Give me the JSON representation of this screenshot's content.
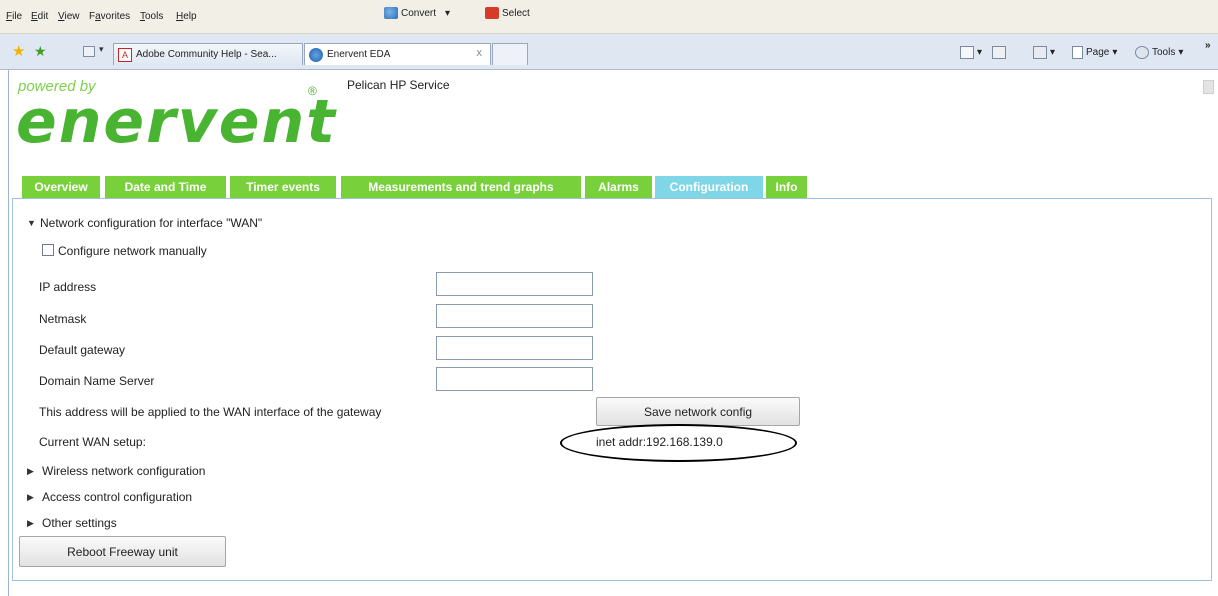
{
  "browser": {
    "menu": [
      {
        "pre": "",
        "u": "F",
        "post": "ile"
      },
      {
        "pre": "",
        "u": "E",
        "post": "dit"
      },
      {
        "pre": "",
        "u": "V",
        "post": "iew"
      },
      {
        "pre": "F",
        "u": "a",
        "post": "vorites"
      },
      {
        "pre": "",
        "u": "T",
        "post": "ools"
      },
      {
        "pre": "",
        "u": "H",
        "post": "elp"
      }
    ],
    "convert_label": "Convert",
    "select_label": "Select",
    "tabs": [
      {
        "title": "Adobe Community Help - Sea..."
      },
      {
        "title": "Enervent EDA",
        "close": "x"
      }
    ],
    "toolbar": {
      "page_label": "Page",
      "tools_label": "Tools",
      "overflow": "»"
    }
  },
  "header": {
    "powered_by": "powered by",
    "logo_text": "enervent",
    "registered": "®",
    "service_title": "Pelican HP Service"
  },
  "nav_tabs": [
    {
      "label": "Overview"
    },
    {
      "label": "Date and Time"
    },
    {
      "label": "Timer events"
    },
    {
      "label": "Measurements and trend graphs"
    },
    {
      "label": "Alarms"
    },
    {
      "label": "Configuration",
      "selected": true
    },
    {
      "label": "Info"
    }
  ],
  "wan_section": {
    "heading": "Network configuration for interface \"WAN\"",
    "manual_checkbox_label": "Configure network manually",
    "manual_checked": false,
    "fields": [
      {
        "label": "IP address",
        "value": ""
      },
      {
        "label": "Netmask",
        "value": ""
      },
      {
        "label": "Default gateway",
        "value": ""
      },
      {
        "label": "Domain Name Server",
        "value": ""
      }
    ],
    "apply_note": "This address will be applied to the WAN interface of the gateway",
    "save_button": "Save network config",
    "current_label": "Current WAN setup:",
    "current_value": "inet addr:192.168.139.0"
  },
  "collapsed_sections": [
    {
      "label": "Wireless network configuration"
    },
    {
      "label": "Access control configuration"
    },
    {
      "label": "Other settings"
    }
  ],
  "reboot_button": "Reboot Freeway unit",
  "colors": {
    "tab_green": "#78d03b",
    "tab_selected": "#7fd6e6",
    "logo_green": "#49b431",
    "panel_border": "#9fc3de"
  }
}
